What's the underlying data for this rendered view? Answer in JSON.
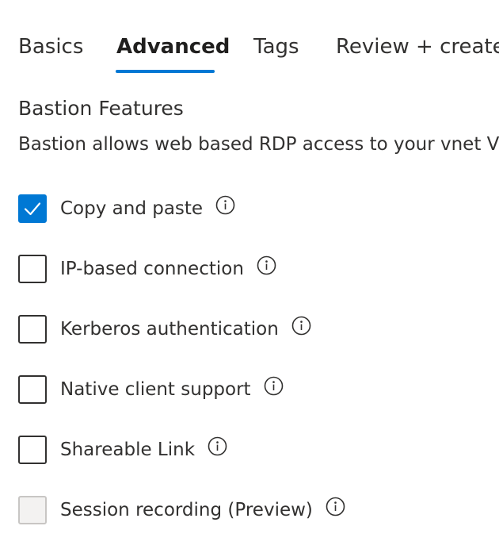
{
  "tabs": [
    {
      "label": "Basics",
      "active": false
    },
    {
      "label": "Advanced",
      "active": true
    },
    {
      "label": "Tags",
      "active": false
    },
    {
      "label": "Review + create",
      "active": false
    }
  ],
  "section": {
    "title": "Bastion Features",
    "description": "Bastion allows web based RDP access to your vnet VM"
  },
  "options": [
    {
      "label": "Copy and paste",
      "checked": true,
      "disabled": false,
      "icon": "info-icon"
    },
    {
      "label": "IP-based connection",
      "checked": false,
      "disabled": false,
      "icon": "info-icon"
    },
    {
      "label": "Kerberos authentication",
      "checked": false,
      "disabled": false,
      "icon": "info-icon"
    },
    {
      "label": "Native client support",
      "checked": false,
      "disabled": false,
      "icon": "info-icon"
    },
    {
      "label": "Shareable Link",
      "checked": false,
      "disabled": false,
      "icon": "info-icon"
    },
    {
      "label": "Session recording (Preview)",
      "checked": false,
      "disabled": true,
      "icon": "info-icon"
    }
  ],
  "colors": {
    "accent": "#0078d4",
    "text": "#323130",
    "disabled_fill": "#f3f2f1"
  }
}
